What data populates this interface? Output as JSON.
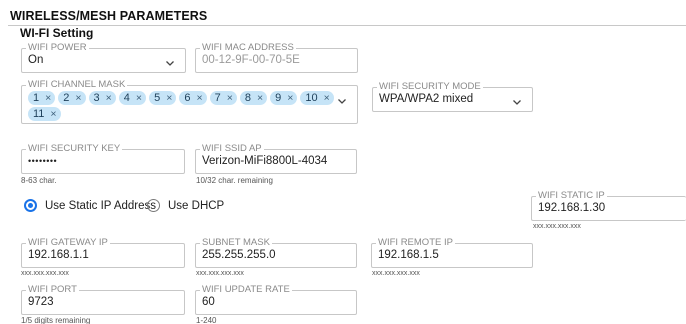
{
  "section": {
    "title": "WIRELESS/MESH PARAMETERS"
  },
  "subsection": {
    "title": "WI-FI Setting"
  },
  "wifi_power": {
    "label": "WIFI POWER",
    "value": "On"
  },
  "wifi_mac": {
    "label": "WIFI MAC ADDRESS",
    "value": "00-12-9F-00-70-5E"
  },
  "channel_mask": {
    "label": "WIFI CHANNEL MASK",
    "chips": [
      "1",
      "2",
      "3",
      "4",
      "5",
      "6",
      "7",
      "8",
      "9",
      "10",
      "11"
    ],
    "remove_glyph": "×"
  },
  "security_mode": {
    "label": "WIFI SECURITY MODE",
    "value": "WPA/WPA2 mixed"
  },
  "security_key": {
    "label": "WIFI SECURITY KEY",
    "value": "••••••••",
    "hint": "8-63 char."
  },
  "ssid": {
    "label": "WIFI SSID AP",
    "value": "Verizon-MiFi8800L-4034",
    "hint": "10/32 char. remaining"
  },
  "ip_mode": {
    "static_label": "Use Static IP Address",
    "dhcp_label": "Use DHCP",
    "selected": "static"
  },
  "static_ip": {
    "label": "WIFI STATIC IP",
    "value": "192.168.1.30",
    "hint": "xxx.xxx.xxx.xxx"
  },
  "gateway_ip": {
    "label": "WIFI GATEWAY IP",
    "value": "192.168.1.1",
    "hint": "xxx.xxx.xxx.xxx"
  },
  "subnet_mask": {
    "label": "SUBNET MASK",
    "value": "255.255.255.0",
    "hint": "xxx.xxx.xxx.xxx"
  },
  "remote_ip": {
    "label": "WIFI REMOTE IP",
    "value": "192.168.1.5",
    "hint": "xxx.xxx.xxx.xxx"
  },
  "wifi_port": {
    "label": "WIFI PORT",
    "value": "9723",
    "hint": "1/5 digits remaining"
  },
  "update_rate": {
    "label": "WIFI UPDATE RATE",
    "value": "60",
    "hint": "1-240"
  },
  "colors": {
    "accent": "#1a73e8",
    "chip_bg": "#c6e4f7",
    "border": "#c7c7c7",
    "label": "#8a8a8a"
  }
}
